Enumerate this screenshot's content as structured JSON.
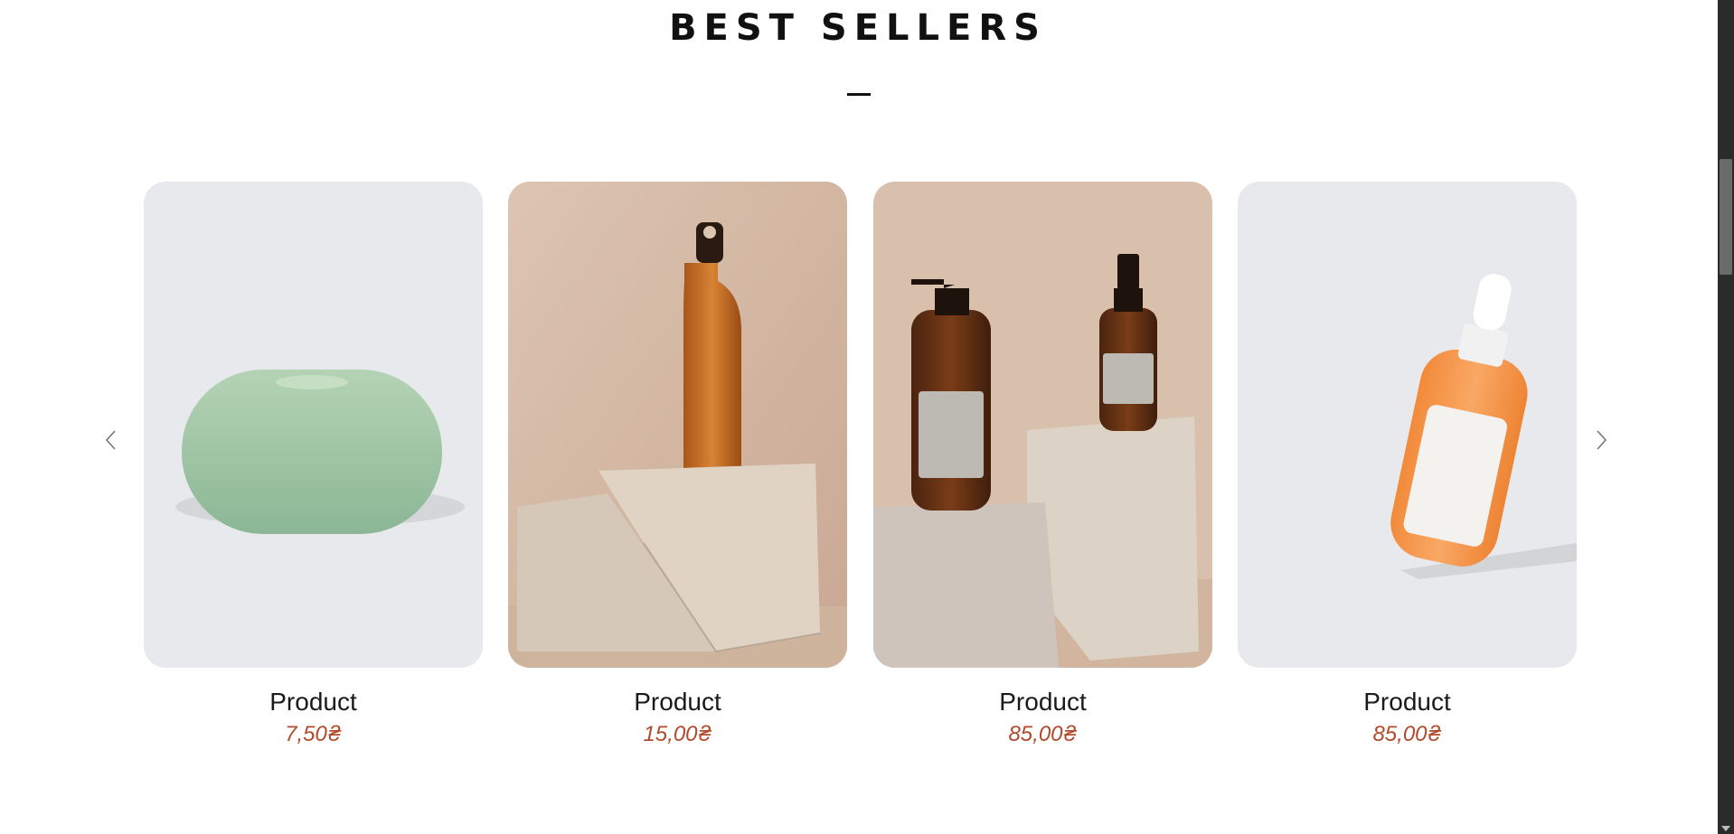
{
  "section": {
    "title": "BEST SELLERS"
  },
  "carousel": {
    "prev_icon": "chevron-left-icon",
    "next_icon": "chevron-right-icon"
  },
  "products": [
    {
      "name": "Product",
      "price": "7,50₴",
      "image": "green-soap-bar"
    },
    {
      "name": "Product",
      "price": "15,00₴",
      "image": "copper-bottle-on-stones"
    },
    {
      "name": "Product",
      "price": "85,00₴",
      "image": "amber-pump-bottles-on-stones"
    },
    {
      "name": "Product",
      "price": "85,00₴",
      "image": "orange-dropper-bottle"
    }
  ],
  "colors": {
    "price": "#b24a2c",
    "title": "#111111",
    "card_gray": "#e8e9ec",
    "card_beige": "#d6bba6"
  }
}
